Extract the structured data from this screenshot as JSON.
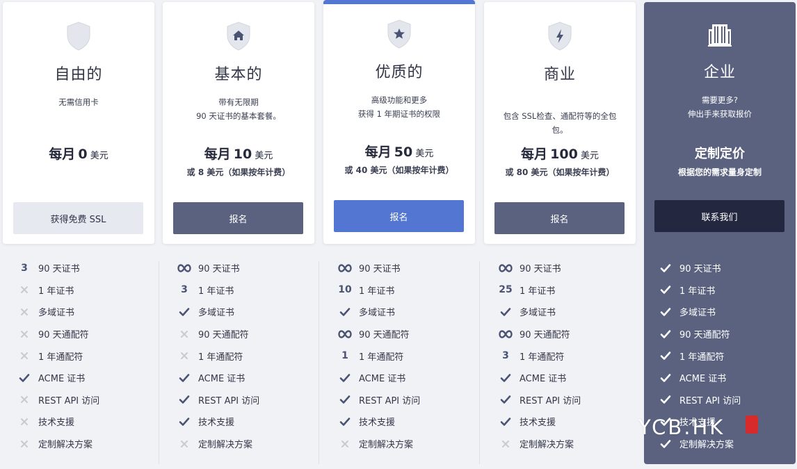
{
  "plans": [
    {
      "title": "自由的",
      "icon": "shield-icon",
      "desc": [
        "无需信用卡",
        ""
      ],
      "price_prefix": "每月",
      "price_amount": "0",
      "price_unit": "美元",
      "yearly": "",
      "button": "获得免费 SSL",
      "features": [
        {
          "mark": "3",
          "label": "90 天证书"
        },
        {
          "mark": "x",
          "label": "1 年证书"
        },
        {
          "mark": "x",
          "label": "多域证书"
        },
        {
          "mark": "x",
          "label": "90 天通配符"
        },
        {
          "mark": "x",
          "label": "1 年通配符"
        },
        {
          "mark": "check",
          "label": "ACME 证书"
        },
        {
          "mark": "x",
          "label": "REST API 访问"
        },
        {
          "mark": "x",
          "label": "技术支援"
        },
        {
          "mark": "x",
          "label": "定制解决方案"
        }
      ]
    },
    {
      "title": "基本的",
      "icon": "home-shield-icon",
      "desc": [
        "带有无限期",
        "90 天证书的基本套餐。"
      ],
      "price_prefix": "每月",
      "price_amount": "10",
      "price_unit": "美元",
      "yearly": "或 8 美元（如果按年计费）",
      "button": "报名",
      "features": [
        {
          "mark": "inf",
          "label": "90 天证书"
        },
        {
          "mark": "3",
          "label": "1 年证书"
        },
        {
          "mark": "check",
          "label": "多域证书"
        },
        {
          "mark": "x",
          "label": "90 天通配符"
        },
        {
          "mark": "x",
          "label": "1 年通配符"
        },
        {
          "mark": "check",
          "label": "ACME 证书"
        },
        {
          "mark": "check",
          "label": "REST API 访问"
        },
        {
          "mark": "check",
          "label": "技术支援"
        },
        {
          "mark": "x",
          "label": "定制解决方案"
        }
      ]
    },
    {
      "title": "优质的",
      "icon": "star-shield-icon",
      "desc": [
        "高级功能和更多",
        "获得 1 年期证书的权限"
      ],
      "price_prefix": "每月",
      "price_amount": "50",
      "price_unit": "美元",
      "yearly": "或 40 美元（如果按年计费）",
      "button": "报名",
      "features": [
        {
          "mark": "inf",
          "label": "90 天证书"
        },
        {
          "mark": "10",
          "label": "1 年证书"
        },
        {
          "mark": "check",
          "label": "多域证书"
        },
        {
          "mark": "inf",
          "label": "90 天通配符"
        },
        {
          "mark": "1",
          "label": "1 年通配符"
        },
        {
          "mark": "check",
          "label": "ACME 证书"
        },
        {
          "mark": "check",
          "label": "REST API 访问"
        },
        {
          "mark": "check",
          "label": "技术支援"
        },
        {
          "mark": "x",
          "label": "定制解决方案"
        }
      ]
    },
    {
      "title": "商业",
      "icon": "bolt-shield-icon",
      "desc": [
        "包含 SSL检查、通配符等的全包",
        "包。"
      ],
      "price_prefix": "每月",
      "price_amount": "100",
      "price_unit": "美元",
      "yearly": "或 80 美元（如果按年计费）",
      "button": "报名",
      "features": [
        {
          "mark": "inf",
          "label": "90 天证书"
        },
        {
          "mark": "25",
          "label": "1 年证书"
        },
        {
          "mark": "check",
          "label": "多域证书"
        },
        {
          "mark": "inf",
          "label": "90 天通配符"
        },
        {
          "mark": "3",
          "label": "1 年通配符"
        },
        {
          "mark": "check",
          "label": "ACME 证书"
        },
        {
          "mark": "check",
          "label": "REST API 访问"
        },
        {
          "mark": "check",
          "label": "技术支援"
        },
        {
          "mark": "x",
          "label": "定制解决方案"
        }
      ]
    }
  ],
  "enterprise": {
    "title": "企业",
    "icon": "building-icon",
    "desc": [
      "需要更多?",
      "伸出手来获取报价"
    ],
    "custom": "定制定价",
    "custom_sub": "根据您的需求量身定制",
    "button": "联系我们",
    "features": [
      {
        "mark": "check",
        "label": "90 天证书"
      },
      {
        "mark": "check",
        "label": "1 年证书"
      },
      {
        "mark": "check",
        "label": "多域证书"
      },
      {
        "mark": "check",
        "label": "90 天通配符"
      },
      {
        "mark": "check",
        "label": "1 年通配符"
      },
      {
        "mark": "check",
        "label": "ACME 证书"
      },
      {
        "mark": "check",
        "label": "REST API 访问"
      },
      {
        "mark": "check",
        "label": "技术支援"
      },
      {
        "mark": "check",
        "label": "定制解决方案"
      }
    ]
  },
  "watermark": "YCB.HK",
  "colors": {
    "accent_blue": "#5376d3",
    "slate": "#5a627f",
    "navy": "#232840",
    "light_button": "#e6e9ef",
    "page_bg": "#f1f2f5"
  }
}
